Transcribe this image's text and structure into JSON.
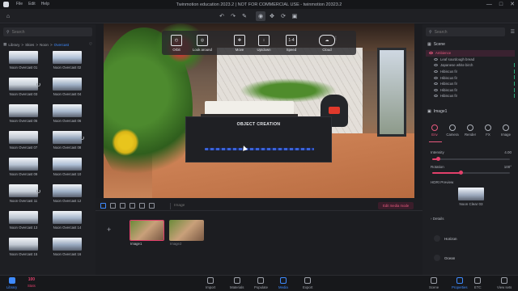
{
  "titlebar": {
    "menu": [
      "File",
      "Edit",
      "Help"
    ],
    "title": "Twinmotion education 2023.2 | NOT FOR COMMERCIAL USE - twinmotion 20323.2",
    "controls": [
      "—",
      "□",
      "✕"
    ]
  },
  "toolbar": {
    "icons": [
      "home-icon",
      "undo-icon",
      "redo-icon",
      "eyedropper-icon",
      "globe-icon",
      "move-icon",
      "rotate-icon",
      "scale-icon"
    ]
  },
  "library": {
    "search_placeholder": "Search",
    "breadcrumb": [
      "Library",
      "Skies",
      "Noon",
      "Overcast"
    ],
    "items": [
      {
        "label": "Noon Overcast 01",
        "loading": false
      },
      {
        "label": "Noon Overcast 02",
        "loading": false
      },
      {
        "label": "Noon Overcast 03",
        "loading": true
      },
      {
        "label": "Noon Overcast 04",
        "loading": false
      },
      {
        "label": "Noon Overcast 05",
        "loading": false
      },
      {
        "label": "Noon Overcast 06",
        "loading": false
      },
      {
        "label": "Noon Overcast 07",
        "loading": false
      },
      {
        "label": "Noon Overcast 08",
        "loading": true
      },
      {
        "label": "Noon Overcast 09",
        "loading": false
      },
      {
        "label": "Noon Overcast 10",
        "loading": false
      },
      {
        "label": "Noon Overcast 11",
        "loading": true
      },
      {
        "label": "Noon Overcast 12",
        "loading": false
      },
      {
        "label": "Noon Overcast 13",
        "loading": false
      },
      {
        "label": "Noon Overcast 14",
        "loading": false
      },
      {
        "label": "Noon Overcast 15",
        "loading": false
      },
      {
        "label": "Noon Overcast 16",
        "loading": false
      }
    ]
  },
  "viewport": {
    "tools": [
      {
        "label": "Orbit",
        "glyph": "◴"
      },
      {
        "label": "Look around",
        "glyph": "◎"
      },
      {
        "label": "Move",
        "glyph": "✥"
      },
      {
        "label": "Up/down",
        "glyph": "↕"
      },
      {
        "label": "Speed",
        "glyph": "1-4"
      },
      {
        "label": "Cloud",
        "glyph": "☁"
      }
    ],
    "modal_title": "OBJECT CREATION"
  },
  "timeline": {
    "media_name_placeholder": "Image",
    "edit_media_label": "Edit media mode",
    "add_label": "+",
    "clips": [
      {
        "label": "Image1",
        "selected": true
      },
      {
        "label": "Image2",
        "selected": false
      }
    ]
  },
  "scene": {
    "search_placeholder": "Search",
    "header": "Scene",
    "items": [
      {
        "label": "Ambience",
        "selected": true,
        "indicator": false
      },
      {
        "label": "Leaf sourdough bread",
        "selected": false,
        "indicator": false
      },
      {
        "label": "Japanese white birch",
        "selected": false,
        "indicator": true
      },
      {
        "label": "Hibiscus fir",
        "selected": false,
        "indicator": true
      },
      {
        "label": "Hibiscus fir",
        "selected": false,
        "indicator": true
      },
      {
        "label": "Hibiscus fir",
        "selected": false,
        "indicator": true
      },
      {
        "label": "Hibiscus fir",
        "selected": false,
        "indicator": true
      },
      {
        "label": "Hibiscus fir",
        "selected": false,
        "indicator": true
      }
    ]
  },
  "properties": {
    "title": "Image1",
    "tabs": [
      "Env",
      "Camera",
      "Render",
      "FX",
      "Image"
    ],
    "active_tab": 0,
    "intensity_label": "Intensity",
    "intensity_value": "4.00",
    "intensity_fraction": 0.07,
    "rotation_label": "Rotation",
    "rotation_value": "100°",
    "rotation_fraction": 0.36,
    "hdri_label": "HDRI Preview",
    "hdri_name": "Noon Clear 03",
    "details_label": "Details",
    "sections": [
      "Horizon",
      "Ocean"
    ]
  },
  "bottombar": {
    "stats_value": "100",
    "stats_label": "Stats",
    "left": [
      {
        "label": "Library",
        "icon": "library-icon"
      }
    ],
    "center": [
      {
        "label": "Import",
        "icon": "import-icon"
      },
      {
        "label": "Materials",
        "icon": "materials-icon"
      },
      {
        "label": "Populate",
        "icon": "populate-icon"
      },
      {
        "label": "Media",
        "icon": "media-icon"
      },
      {
        "label": "Export",
        "icon": "export-icon"
      }
    ],
    "right": [
      {
        "label": "Scene",
        "icon": "scene-icon"
      },
      {
        "label": "Properties",
        "icon": "properties-icon"
      },
      {
        "label": "ETC",
        "icon": "etc-icon"
      },
      {
        "label": "View sets",
        "icon": "view-sets-icon"
      }
    ]
  },
  "colors": {
    "accent": "#3f8bff",
    "pink": "#e2406b",
    "background": "#1b1c20"
  }
}
